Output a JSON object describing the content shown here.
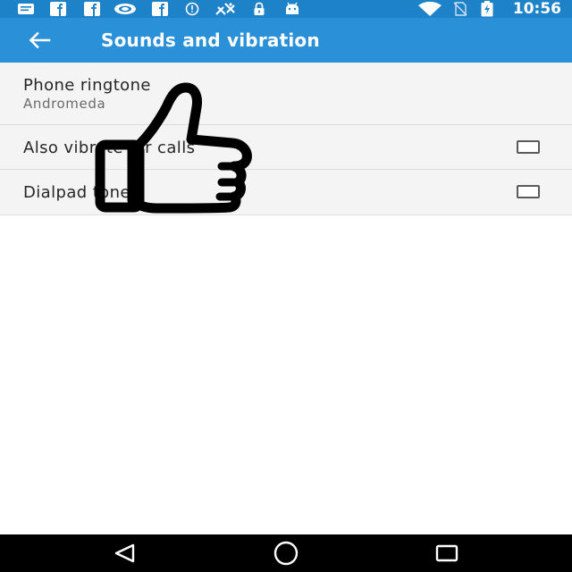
{
  "status_bar": {
    "time": "10:56",
    "left_icons": [
      "notes-icon",
      "facebook-icon",
      "facebook-icon",
      "eye-icon",
      "facebook-icon",
      "info-icon",
      "no-signal-icon",
      "lock-icon",
      "android-icon"
    ],
    "right_icons": [
      "wifi-icon",
      "no-sim-icon",
      "battery-charging-icon"
    ],
    "background": "#1e82c8"
  },
  "app_bar": {
    "title": "Sounds and vibration",
    "back_icon": "back-arrow-icon",
    "background": "#2a90d8"
  },
  "settings": {
    "ringtone": {
      "title": "Phone ringtone",
      "summary": "Andromeda"
    },
    "vibrate": {
      "title": "Also vibrate for calls",
      "checked": false
    },
    "dialpad": {
      "title": "Dialpad tones",
      "checked": false
    }
  },
  "overlay": {
    "icon": "thumbs-up-icon"
  },
  "nav_bar": {
    "icons": [
      "back-triangle-icon",
      "home-circle-icon",
      "recents-square-icon"
    ]
  }
}
